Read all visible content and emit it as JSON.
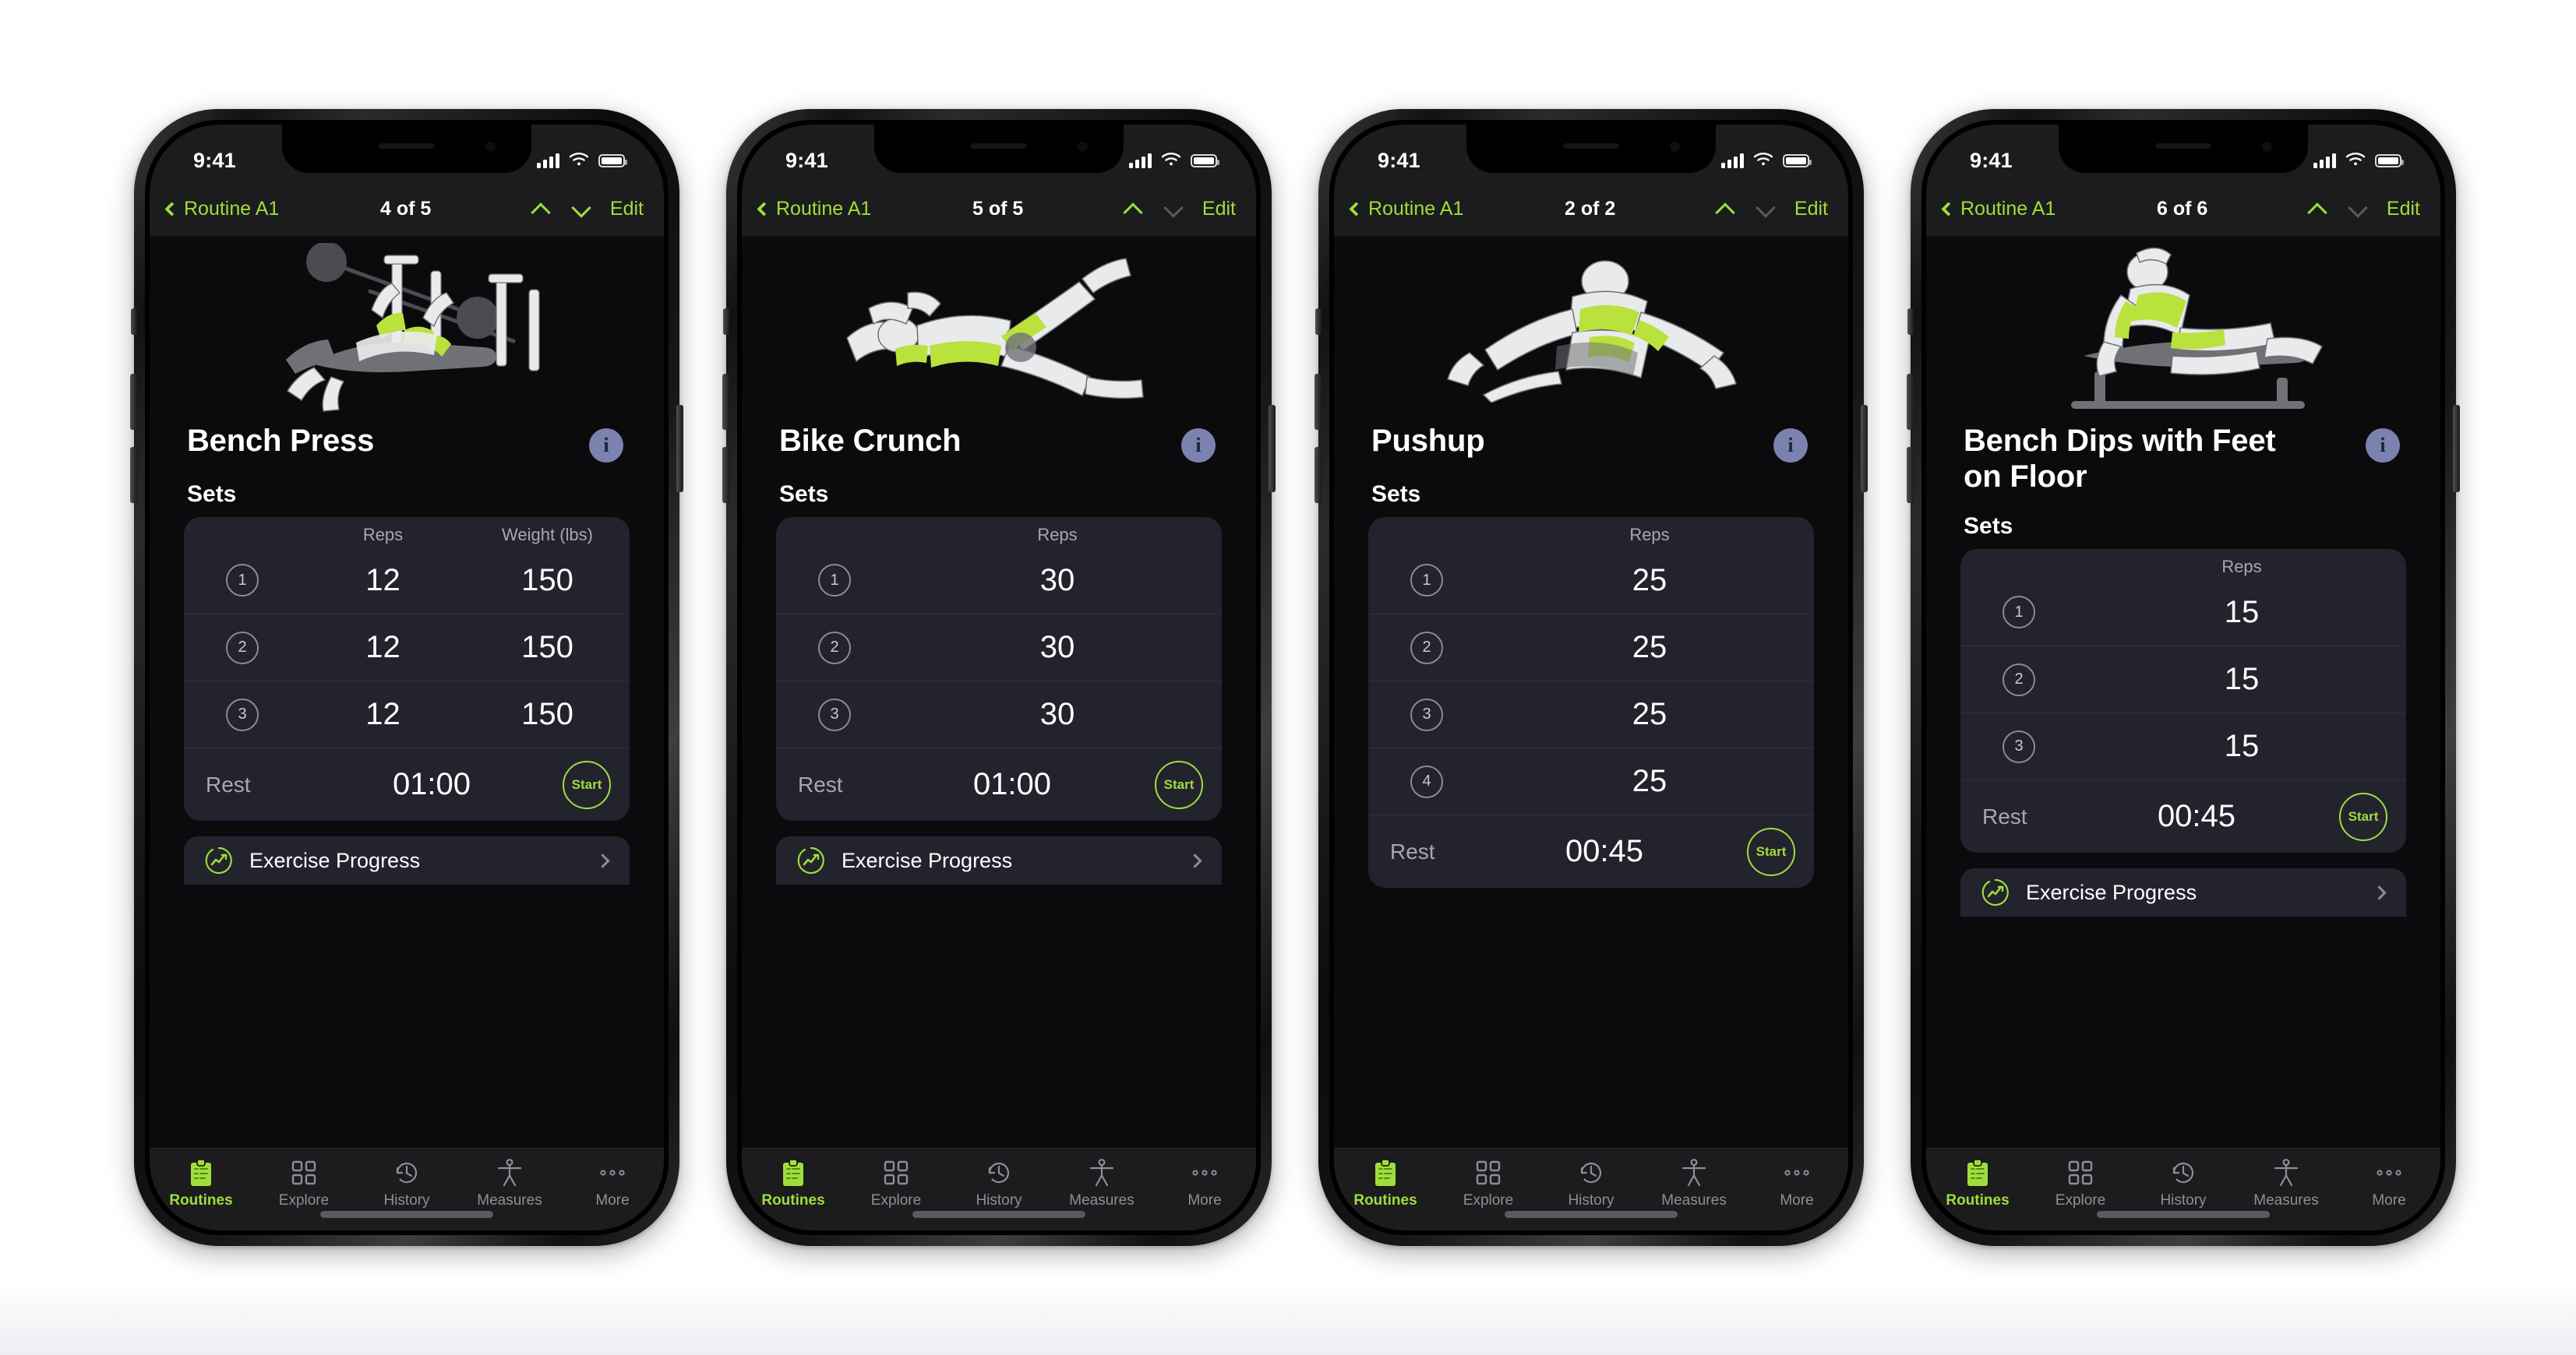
{
  "app": {
    "accent_green": "#9ede3c",
    "info_badge_color": "#7b82ad",
    "card_bg": "#23232e",
    "screen_bg": "#0b0b0e",
    "bar_bg": "#1c1c1e"
  },
  "status_bar": {
    "time": "9:41",
    "signal": "signal-bars-icon",
    "wifi": "wifi-icon",
    "battery": "battery-icon"
  },
  "nav": {
    "back_label": "Routine A1",
    "edit_label": "Edit",
    "up_icon": "chevron-up-icon",
    "down_icon": "chevron-down-icon"
  },
  "labels": {
    "sets_heading": "Sets",
    "col_index": "",
    "col_reps": "Reps",
    "col_weight": "Weight (lbs)",
    "rest": "Rest",
    "start": "Start",
    "exercise_progress": "Exercise Progress",
    "info": "i"
  },
  "tabs": [
    {
      "label": "Routines",
      "icon": "clipboard-icon",
      "active": true
    },
    {
      "label": "Explore",
      "icon": "grid-icon",
      "active": false
    },
    {
      "label": "History",
      "icon": "clock-rewind-icon",
      "active": false
    },
    {
      "label": "Measures",
      "icon": "body-figure-icon",
      "active": false
    },
    {
      "label": "More",
      "icon": "ellipsis-icon",
      "active": false
    }
  ],
  "phones": [
    {
      "counter": "4 of 5",
      "up_enabled": true,
      "down_enabled": true,
      "exercise": "Bench Press",
      "illustration": "bench-press-illustration",
      "show_weight": true,
      "sets": [
        {
          "index": "1",
          "reps": "12",
          "weight": "150"
        },
        {
          "index": "2",
          "reps": "12",
          "weight": "150"
        },
        {
          "index": "3",
          "reps": "12",
          "weight": "150"
        }
      ],
      "rest": "01:00",
      "show_progress": true
    },
    {
      "counter": "5 of 5",
      "up_enabled": true,
      "down_enabled": false,
      "exercise": "Bike Crunch",
      "illustration": "bike-crunch-illustration",
      "show_weight": false,
      "sets": [
        {
          "index": "1",
          "reps": "30",
          "weight": ""
        },
        {
          "index": "2",
          "reps": "30",
          "weight": ""
        },
        {
          "index": "3",
          "reps": "30",
          "weight": ""
        }
      ],
      "rest": "01:00",
      "show_progress": true
    },
    {
      "counter": "2 of 2",
      "up_enabled": true,
      "down_enabled": false,
      "exercise": "Pushup",
      "illustration": "pushup-illustration",
      "show_weight": false,
      "sets": [
        {
          "index": "1",
          "reps": "25",
          "weight": ""
        },
        {
          "index": "2",
          "reps": "25",
          "weight": ""
        },
        {
          "index": "3",
          "reps": "25",
          "weight": ""
        },
        {
          "index": "4",
          "reps": "25",
          "weight": ""
        }
      ],
      "rest": "00:45",
      "show_progress": false
    },
    {
      "counter": "6 of 6",
      "up_enabled": true,
      "down_enabled": false,
      "exercise": "Bench Dips with Feet on Floor",
      "illustration": "bench-dips-illustration",
      "show_weight": false,
      "sets": [
        {
          "index": "1",
          "reps": "15",
          "weight": ""
        },
        {
          "index": "2",
          "reps": "15",
          "weight": ""
        },
        {
          "index": "3",
          "reps": "15",
          "weight": ""
        }
      ],
      "rest": "00:45",
      "show_progress": true
    }
  ]
}
